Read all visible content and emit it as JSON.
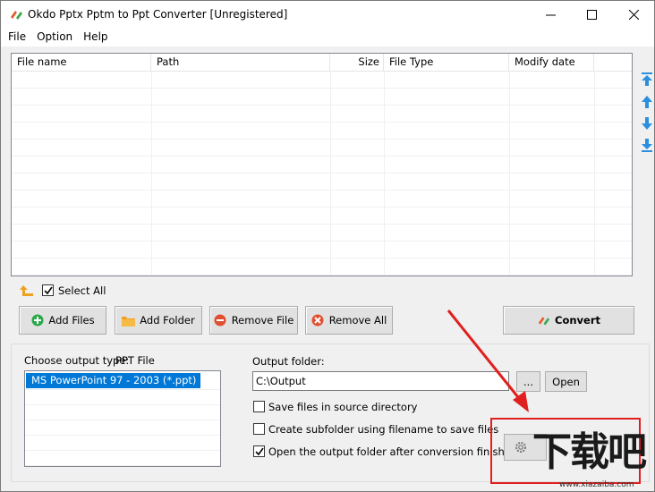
{
  "window": {
    "title": "Okdo Pptx Pptm to Ppt Converter [Unregistered]"
  },
  "menu": [
    "File",
    "Option",
    "Help"
  ],
  "file_table": {
    "columns": [
      "File name",
      "Path",
      "Size",
      "File Type",
      "Modify date"
    ],
    "rows": []
  },
  "list_controls": {
    "select_all_label": "Select All",
    "select_all_checked": true
  },
  "toolbar": {
    "add_files": "Add Files",
    "add_folder": "Add Folder",
    "remove_file": "Remove File",
    "remove_all": "Remove All",
    "convert": "Convert"
  },
  "output": {
    "choose_type_label": "Choose output type:",
    "selected_type_name": "PPT File",
    "types": [
      "MS PowerPoint 97 - 2003 (*.ppt)"
    ],
    "folder_label": "Output folder:",
    "folder_value": "C:\\Output",
    "browse_label": "...",
    "open_label": "Open"
  },
  "options": [
    {
      "label": "Save files in source directory",
      "checked": false
    },
    {
      "label": "Create subfolder using filename to save files",
      "checked": false
    },
    {
      "label": "Open the output folder after conversion finished",
      "checked": true
    }
  ],
  "watermark": {
    "text": "下载吧",
    "url": "www.xiazaiba.com"
  },
  "colors": {
    "accent": "#0078d7",
    "highlight_box": "#e0201e",
    "arrow_blue": "#2b8fe0",
    "folder_orange": "#f0a020",
    "add_green": "#2aa84a",
    "remove_red": "#e05030"
  }
}
